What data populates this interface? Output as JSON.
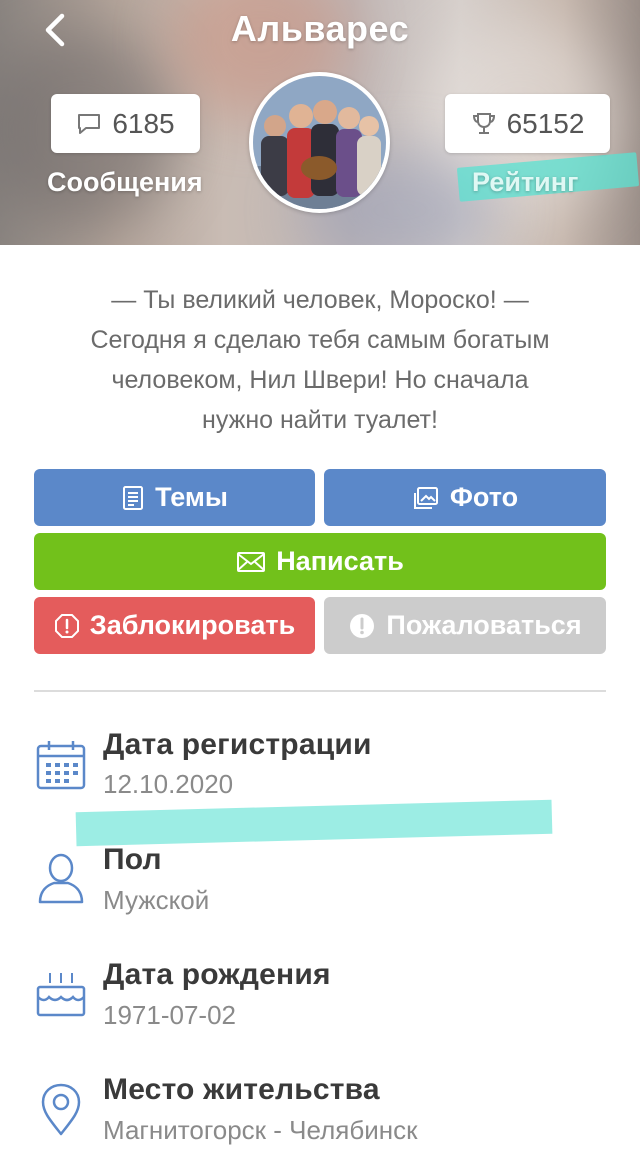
{
  "header": {
    "title": "Альварес",
    "back_icon": "chevron-left-icon"
  },
  "stats": {
    "messages": {
      "value": "6185",
      "label": "Сообщения",
      "icon": "chat-bubble-icon"
    },
    "rating": {
      "value": "65152",
      "label": "Рейтинг",
      "icon": "trophy-icon"
    }
  },
  "bio": {
    "lines": [
      "— Ты великий человек, Мороско!  —",
      "Сегодня я сделаю тебя самым богатым",
      "человеком, Нил Швери! Но сначала",
      "нужно найти туалет!"
    ]
  },
  "buttons": {
    "topics": "Темы",
    "photo": "Фото",
    "write": "Написать",
    "block": "Заблокировать",
    "report": "Пожаловаться"
  },
  "colors": {
    "blue_button": "#5b88c9",
    "green_button": "#72c11b",
    "red_button": "#e45c5c",
    "gray_button": "#cccccc",
    "icon_blue": "#5b88c9",
    "highlight": "#5ae1d2"
  },
  "info": [
    {
      "title": "Дата регистрации",
      "value": "12.10.2020",
      "icon": "calendar-icon"
    },
    {
      "title": "Пол",
      "value": "Мужской",
      "icon": "person-icon"
    },
    {
      "title": "Дата рождения",
      "value": "1971-07-02",
      "icon": "birthday-cake-icon"
    },
    {
      "title": "Место жительства",
      "value": "Магнитогорск - Челябинск",
      "icon": "location-pin-icon"
    }
  ]
}
